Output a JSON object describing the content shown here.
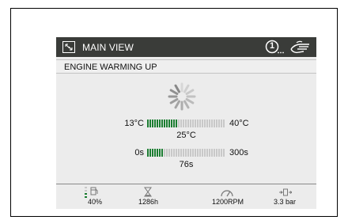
{
  "titlebar": {
    "title": "MAIN VIEW",
    "icon": "screen-view-icon",
    "alert_icon": "notification-count-icon",
    "alert_count": "1",
    "hand_icon": "hand-touch-icon"
  },
  "status": {
    "text": "ENGINE WARMING UP"
  },
  "temperature": {
    "min_label": "13°C",
    "max_label": "40°C",
    "value_label": "25°C",
    "level": 0.38
  },
  "time": {
    "min_label": "0s",
    "max_label": "300s",
    "value_label": "76s",
    "level": 0.22
  },
  "footer": [
    {
      "icon": "fuel-level-icon",
      "value": "40%"
    },
    {
      "icon": "hourglass-icon",
      "value": "1286h"
    },
    {
      "icon": "speedometer-icon",
      "value": "1200RPM"
    },
    {
      "icon": "pressure-icon",
      "value": "3.3 bar"
    }
  ],
  "colors": {
    "titlebar_bg": "#3a3c39",
    "bar_active": "#1b7d31",
    "bar_inactive": "#c8c8c8"
  }
}
